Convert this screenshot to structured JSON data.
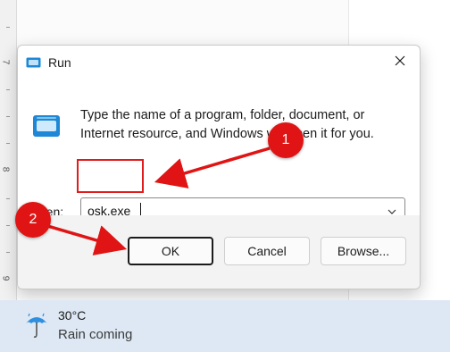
{
  "background": {
    "ruler_numbers": [
      "7",
      "8",
      "9"
    ]
  },
  "dialog": {
    "title": "Run",
    "description": "Type the name of a program, folder, document, or Internet resource, and Windows will open it for you.",
    "open_label": "Open:",
    "open_value": "osk.exe",
    "buttons": {
      "ok": "OK",
      "cancel": "Cancel",
      "browse": "Browse..."
    },
    "icons": {
      "title": "run-icon",
      "body": "run-icon",
      "close": "close-icon",
      "dropdown": "chevron-down-icon"
    }
  },
  "taskbar": {
    "temperature": "30°C",
    "forecast": "Rain coming",
    "weather_icon": "rain-umbrella-icon"
  },
  "annotations": {
    "badge_1": "1",
    "badge_2": "2",
    "color": "#e01414"
  }
}
